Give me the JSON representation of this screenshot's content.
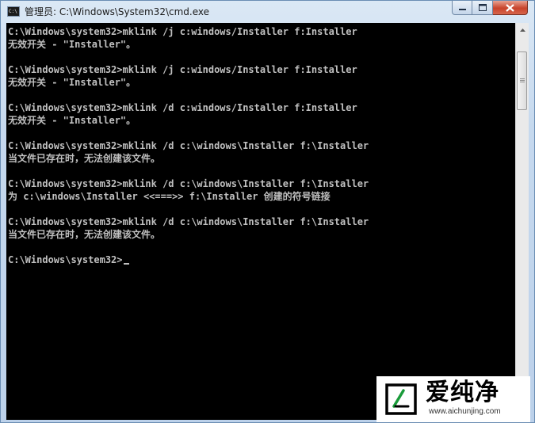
{
  "window": {
    "title": "管理员: C:\\Windows\\System32\\cmd.exe",
    "icon": "cmd-icon",
    "icon_text": "C:\\"
  },
  "console": {
    "lines": [
      "C:\\Windows\\system32>mklink /j c:windows/Installer f:Installer",
      "无效开关 - \"Installer\"。",
      "",
      "C:\\Windows\\system32>mklink /j c:windows/Installer f:Installer",
      "无效开关 - \"Installer\"。",
      "",
      "C:\\Windows\\system32>mklink /d c:windows/Installer f:Installer",
      "无效开关 - \"Installer\"。",
      "",
      "C:\\Windows\\system32>mklink /d c:\\windows\\Installer f:\\Installer",
      "当文件已存在时，无法创建该文件。",
      "",
      "C:\\Windows\\system32>mklink /d c:\\windows\\Installer f:\\Installer",
      "为 c:\\windows\\Installer <<===>> f:\\Installer 创建的符号链接",
      "",
      "C:\\Windows\\system32>mklink /d c:\\windows\\Installer f:\\Installer",
      "当文件已存在时，无法创建该文件。",
      "",
      "C:\\Windows\\system32>"
    ]
  },
  "colors": {
    "console_bg": "#000000",
    "console_text": "#c0c0c0",
    "close_button": "#c8432b"
  },
  "watermark": {
    "name": "爱纯净",
    "url": "www.aichunjing.com"
  }
}
